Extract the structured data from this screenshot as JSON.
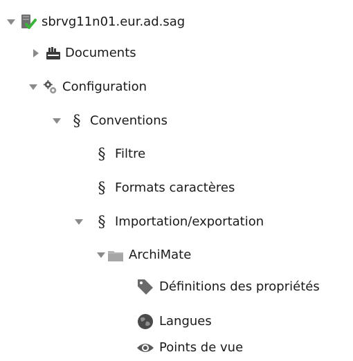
{
  "tree": {
    "root": {
      "label": "sbrvg11n01.eur.ad.sag",
      "expanded": true,
      "icon": "server-check-icon"
    },
    "documents": {
      "label": "Documents",
      "expanded": false,
      "icon": "documents-icon"
    },
    "configuration": {
      "label": "Configuration",
      "expanded": true,
      "icon": "gears-icon"
    },
    "conventions": {
      "label": "Conventions",
      "expanded": true,
      "icon": "section-icon"
    },
    "filtre": {
      "label": "Filtre",
      "icon": "section-icon"
    },
    "formats": {
      "label": "Formats caractères",
      "icon": "section-icon"
    },
    "importation": {
      "label": "Importation/exportation",
      "expanded": true,
      "icon": "section-icon"
    },
    "archimate": {
      "label": "ArchiMate",
      "expanded": true,
      "icon": "folder-icon"
    },
    "definitions": {
      "label": "Définitions des propriétés",
      "icon": "tag-icon"
    },
    "langues": {
      "label": "Langues",
      "icon": "globe-icon"
    },
    "points": {
      "label": "Points de vue",
      "icon": "eye-icon"
    }
  },
  "colors": {
    "arrow": "#8a8a8a",
    "folder": "#b5b5b5",
    "check": "#3bb33b",
    "icon_dark": "#4a4a4a"
  }
}
